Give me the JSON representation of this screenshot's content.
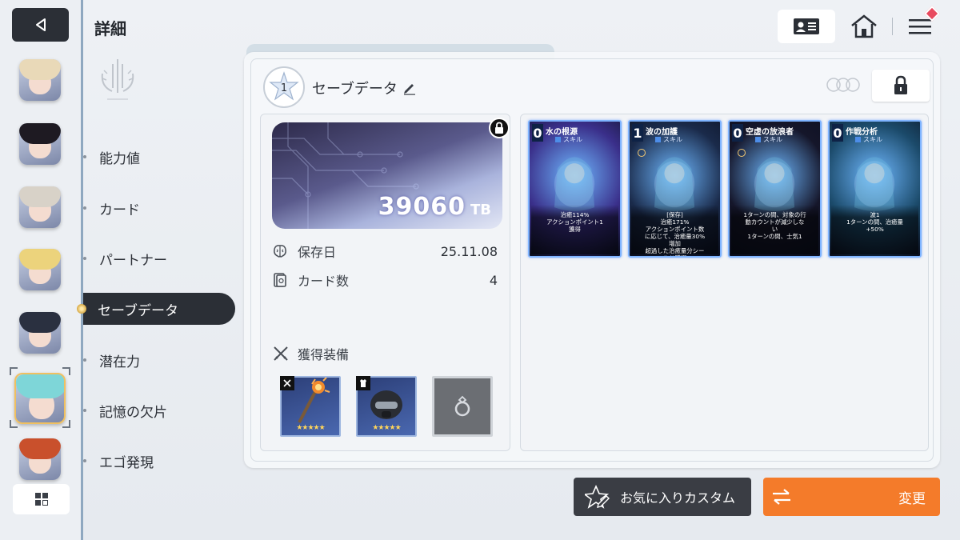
{
  "header": {
    "title": "詳細"
  },
  "menu": {
    "items": [
      {
        "label": "能力値",
        "active": false
      },
      {
        "label": "カード",
        "active": false
      },
      {
        "label": "パートナー",
        "active": false
      },
      {
        "label": "セーブデータ",
        "active": true
      },
      {
        "label": "潜在力",
        "active": false
      },
      {
        "label": "記憶の欠片",
        "active": false
      },
      {
        "label": "エゴ発現",
        "active": false
      }
    ]
  },
  "characters": [
    {
      "name": "character-1",
      "hair": "#e9d9b8"
    },
    {
      "name": "character-2",
      "hair": "#1e1a22"
    },
    {
      "name": "character-3",
      "hair": "#d8d2c8"
    },
    {
      "name": "character-4",
      "hair": "#ecd37c"
    },
    {
      "name": "character-5",
      "hair": "#2a3040"
    },
    {
      "name": "character-6",
      "hair": "#7ed6d8",
      "selected": true
    },
    {
      "name": "character-7",
      "hair": "#c9502c"
    }
  ],
  "save": {
    "slot_number": "1",
    "title": "セーブデータ",
    "tb_value": "39060",
    "tb_unit": "TB",
    "save_date_label": "保存日",
    "save_date": "25.11.08",
    "card_count_label": "カード数",
    "card_count": "4",
    "equipment_title": "獲得装備",
    "equipment": [
      {
        "type": "weapon",
        "stars": "★★★★★"
      },
      {
        "type": "armor",
        "stars": "★★★★★"
      },
      {
        "type": "ring",
        "empty": true
      }
    ]
  },
  "cards": [
    {
      "cost": "0",
      "name": "水の根源",
      "type": "スキル",
      "desc": "治癒114%\nアクションポイント1\n獲得",
      "bg": "#3a2f8a"
    },
    {
      "cost": "1",
      "name": "波の加護",
      "type": "スキル",
      "desc": "[保存]\n治癒171%\nアクションポイント数\nに応じて、治癒量30%\n増加\n超過した治癒量分シー\nルド獲得",
      "bg": "#1a2a4a"
    },
    {
      "cost": "0",
      "name": "空虚の放浪者",
      "type": "スキル",
      "desc": "1ターンの間、対象の行\n動カウントが減少しな\nい\n1ターンの間、士気1",
      "bg": "#15162a"
    },
    {
      "cost": "0",
      "name": "作戦分析",
      "type": "スキル",
      "desc": "波1\n1ターンの間、治癒量\n+50%",
      "bg": "#1b4a6a"
    }
  ],
  "buttons": {
    "favorite": "お気に入りカスタム",
    "change": "変更"
  },
  "colors": {
    "accent": "#f47b2a",
    "dark": "#2b2f36",
    "card_border": "#7fb4ff"
  }
}
